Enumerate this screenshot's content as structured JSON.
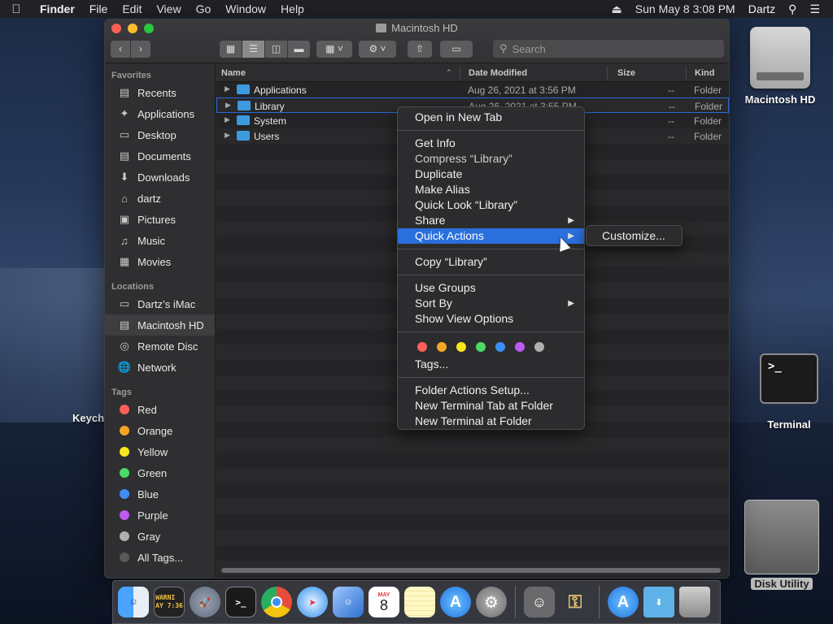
{
  "menubar": {
    "app_name": "Finder",
    "items": [
      "File",
      "Edit",
      "View",
      "Go",
      "Window",
      "Help"
    ],
    "clock": "Sun May 8  3:08 PM",
    "user": "Dartz"
  },
  "window": {
    "title": "Macintosh HD",
    "search_placeholder": "Search"
  },
  "sidebar": {
    "favorites_header": "Favorites",
    "favorites": [
      {
        "label": "Recents"
      },
      {
        "label": "Applications"
      },
      {
        "label": "Desktop"
      },
      {
        "label": "Documents"
      },
      {
        "label": "Downloads"
      },
      {
        "label": "dartz"
      },
      {
        "label": "Pictures"
      },
      {
        "label": "Music"
      },
      {
        "label": "Movies"
      }
    ],
    "locations_header": "Locations",
    "locations": [
      {
        "label": "Dartz’s iMac"
      },
      {
        "label": "Macintosh HD"
      },
      {
        "label": "Remote Disc"
      },
      {
        "label": "Network"
      }
    ],
    "tags_header": "Tags",
    "tags": [
      {
        "label": "Red",
        "color": "#fc5f57"
      },
      {
        "label": "Orange",
        "color": "#f5a623"
      },
      {
        "label": "Yellow",
        "color": "#f8e71c"
      },
      {
        "label": "Green",
        "color": "#4cd964"
      },
      {
        "label": "Blue",
        "color": "#3d8ef7"
      },
      {
        "label": "Purple",
        "color": "#bf5af2"
      },
      {
        "label": "Gray",
        "color": "#b0b0b0"
      },
      {
        "label": "All Tags..."
      }
    ]
  },
  "columns": {
    "name": "Name",
    "date": "Date Modified",
    "size": "Size",
    "kind": "Kind"
  },
  "files": [
    {
      "name": "Applications",
      "date": "Aug 26, 2021 at 3:56 PM",
      "size": "--",
      "kind": "Folder"
    },
    {
      "name": "Library",
      "date": "Aug 26, 2021 at 3:55 PM",
      "size": "--",
      "kind": "Folder"
    },
    {
      "name": "System",
      "date": "",
      "size": "--",
      "kind": "Folder"
    },
    {
      "name": "Users",
      "date": "",
      "size": "--",
      "kind": "Folder"
    }
  ],
  "context_menu": {
    "open_new_tab": "Open in New Tab",
    "get_info": "Get Info",
    "compress": "Compress “Library”",
    "duplicate": "Duplicate",
    "make_alias": "Make Alias",
    "quick_look": "Quick Look “Library”",
    "share": "Share",
    "quick_actions": "Quick Actions",
    "copy": "Copy “Library”",
    "use_groups": "Use Groups",
    "sort_by": "Sort By",
    "show_view_options": "Show View Options",
    "tag_colors": [
      "#fc5f57",
      "#f5a623",
      "#f8e71c",
      "#4cd964",
      "#3d8ef7",
      "#bf5af2",
      "#b0b0b0"
    ],
    "tags": "Tags...",
    "folder_actions_setup": "Folder Actions Setup...",
    "new_terminal_tab": "New Terminal Tab at Folder",
    "new_terminal": "New Terminal at Folder"
  },
  "submenu": {
    "customize": "Customize..."
  },
  "desktop": {
    "hd_label": "Macintosh HD",
    "terminal_label": "Terminal",
    "terminal_prompt": ">_",
    "disk_utility_label": "Disk Utility",
    "keychain_label": "Keych"
  },
  "dock": {
    "console_text": "WARNI\nAY 7:36",
    "calendar_month": "MAY",
    "calendar_day": "8"
  }
}
